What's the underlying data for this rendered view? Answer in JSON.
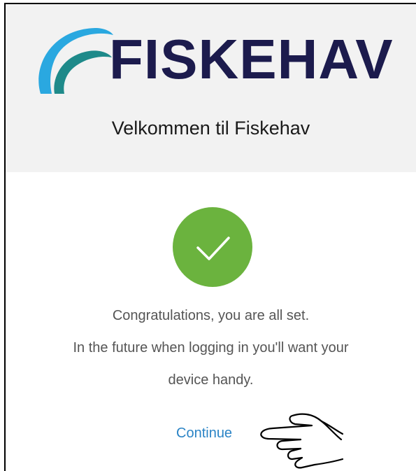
{
  "header": {
    "brand_name": "FISKEHAV",
    "welcome_text": "Velkommen til Fiskehav"
  },
  "status": {
    "line1": "Congratulations, you are all set.",
    "line2": "In the future when logging in you'll want your",
    "line3": "device handy."
  },
  "actions": {
    "continue_label": "Continue"
  },
  "icons": {
    "logo_mark": "wave-logo-icon",
    "success": "checkmark-icon",
    "pointer": "pointing-hand-icon"
  },
  "colors": {
    "brand_navy": "#1c1b4d",
    "logo_blue": "#2aa8e0",
    "logo_teal": "#1e8a8a",
    "success_green": "#6bb33e",
    "link_blue": "#2b84c6",
    "header_bg": "#f2f2f2"
  }
}
